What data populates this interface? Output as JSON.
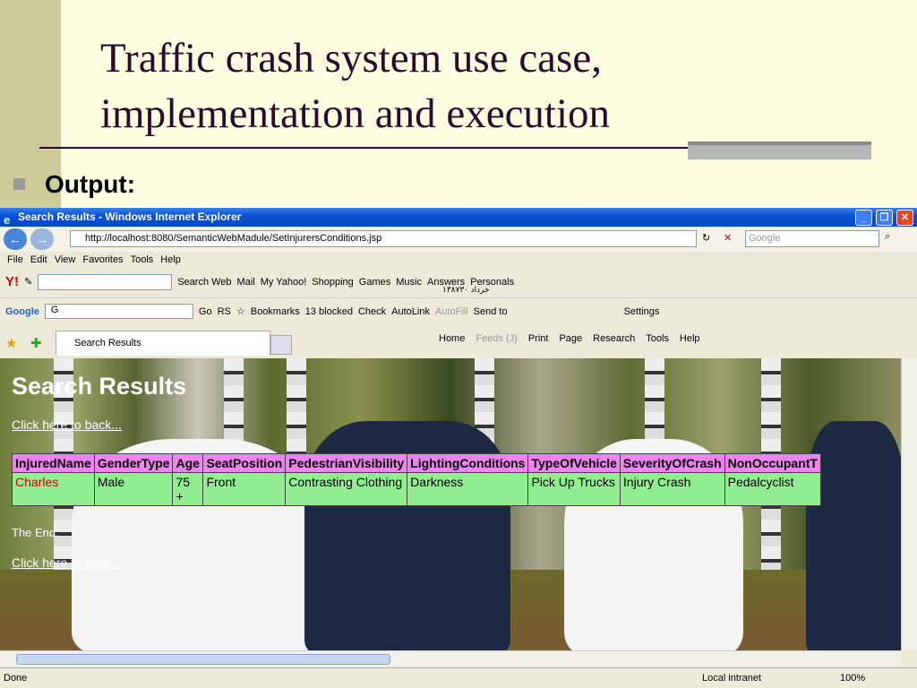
{
  "slide": {
    "title": "Traffic crash system use case, implementation and execution",
    "bullet": "Output:"
  },
  "browser": {
    "window_title": "Search Results - Windows Internet Explorer",
    "url": "http://localhost:8080/SemanticWebMadule/SetInjurersConditions.jsp",
    "search_placeholder": "Google",
    "menu": [
      "File",
      "Edit",
      "View",
      "Favorites",
      "Tools",
      "Help"
    ],
    "yahoo_toolbar": [
      "Search Web",
      "Mail",
      "My Yahoo!",
      "Shopping",
      "Games",
      "Music",
      "Answers",
      "Personals"
    ],
    "yahoo_date": "۱۳۸۷خرداد ۳۰",
    "google_toolbar": [
      "Go",
      "RS",
      "Bookmarks",
      "13 blocked",
      "Check",
      "AutoLink",
      "AutoFill",
      "Send to",
      "Settings"
    ],
    "google_label": "Google",
    "google_dropdown": "G",
    "tab_title": "Search Results",
    "command_bar": [
      "Home",
      "Feeds (J)",
      "Print",
      "Page",
      "Research",
      "Tools",
      "Help"
    ],
    "status": "Done",
    "zone": "Local intranet",
    "zoom": "100%"
  },
  "page": {
    "heading": "Search Results",
    "back_link": "Click here to back...",
    "end_text": "The End.",
    "table": {
      "columns": [
        "InjuredName",
        "GenderType",
        "Age",
        "SeatPosition",
        "PedestrianVisibility",
        "LightingConditions",
        "TypeOfVehicle",
        "SeverityOfCrash",
        "NonOccupantT"
      ],
      "rows": [
        [
          "Charles",
          "Male",
          "75 +",
          "Front",
          "Contrasting Clothing",
          "Darkness",
          "Pick Up Trucks",
          "Injury Crash",
          "Pedalcyclist"
        ]
      ]
    }
  }
}
